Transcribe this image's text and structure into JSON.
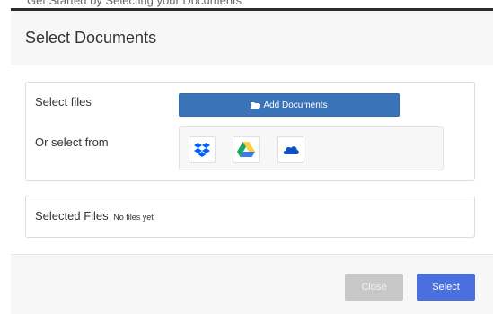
{
  "background_partial_text": "Get Started by Selecting your Documents",
  "modal": {
    "title": "Select Documents",
    "select_files_label": "Select files",
    "add_documents_label": "Add Documents",
    "or_select_from_label": "Or select from",
    "sources": [
      "dropbox-icon",
      "google-drive-icon",
      "onedrive-icon"
    ],
    "selected_files_label": "Selected Files",
    "no_files_text": "No files yet",
    "close_label": "Close",
    "select_label": "Select"
  },
  "colors": {
    "primary": "#3b73b9",
    "select_button": "#4a70e0",
    "close_button_disabled": "#c8c8c8",
    "dropbox": "#0061fe",
    "onedrive": "#0f4fc4"
  }
}
